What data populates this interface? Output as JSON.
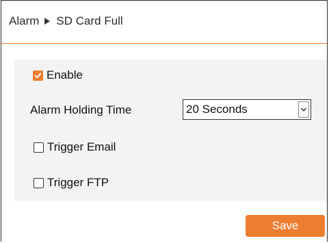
{
  "breadcrumb": {
    "section": "Alarm",
    "page": "SD Card Full"
  },
  "form": {
    "enable": {
      "label": "Enable",
      "checked": true
    },
    "holding_time": {
      "label": "Alarm Holding Time",
      "value": "20 Seconds"
    },
    "trigger_email": {
      "label": "Trigger Email",
      "checked": false
    },
    "trigger_ftp": {
      "label": "Trigger FTP",
      "checked": false
    }
  },
  "actions": {
    "save_label": "Save"
  },
  "colors": {
    "accent": "#ed7d31",
    "panel_bg": "#f3f3f3",
    "border": "#2b2b2b"
  },
  "icons": {
    "breadcrumb_separator": "triangle-right-icon",
    "checkmark": "checkmark-icon",
    "dropdown": "chevron-down-icon"
  }
}
